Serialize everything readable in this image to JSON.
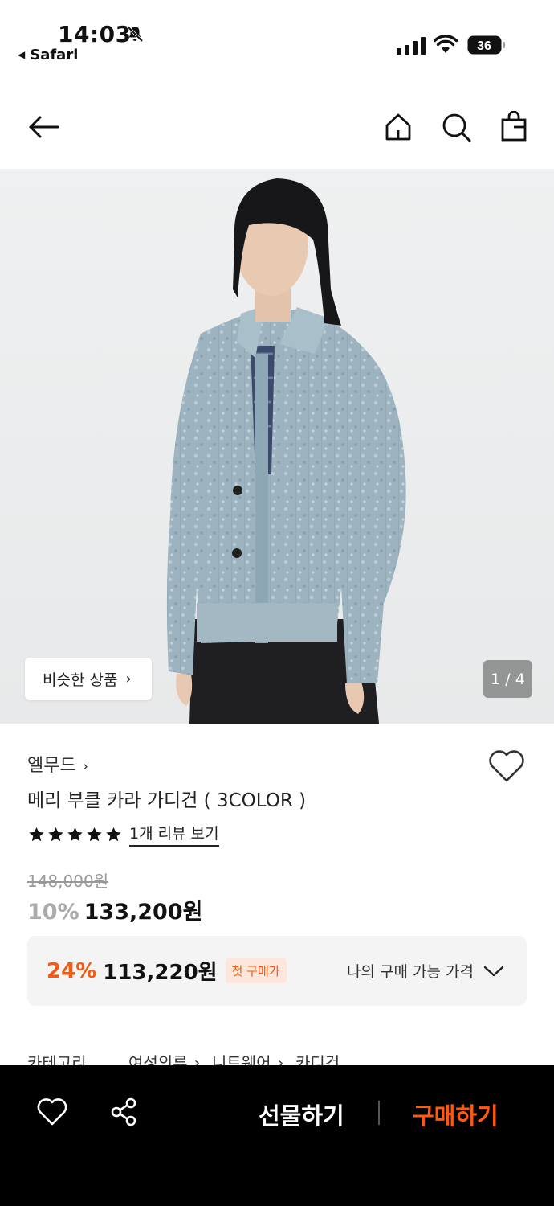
{
  "status_bar": {
    "time": "14:03",
    "back_app": "Safari",
    "battery": "36"
  },
  "hero": {
    "similar_label": "비슷한 상품",
    "page_indicator": "1 / 4"
  },
  "product": {
    "brand": "엘무드",
    "title": "메리 부클 카라 가디건 ( 3COLOR )",
    "rating_stars": 5,
    "review_link": "1개 리뷰 보기",
    "original_price": "148,000원",
    "discount": "10%",
    "price": "133,200원"
  },
  "benefit": {
    "percent": "24%",
    "price": "113,220원",
    "badge": "첫 구매가",
    "toggle_label": "나의 구매 가능 가격"
  },
  "category": {
    "label": "카테고리",
    "path": [
      "여성의류",
      "니트웨어",
      "카디건"
    ]
  },
  "bottom_bar": {
    "gift": "선물하기",
    "buy": "구매하기"
  },
  "colors": {
    "accent": "#f55a10",
    "bar_bg": "#000000"
  }
}
